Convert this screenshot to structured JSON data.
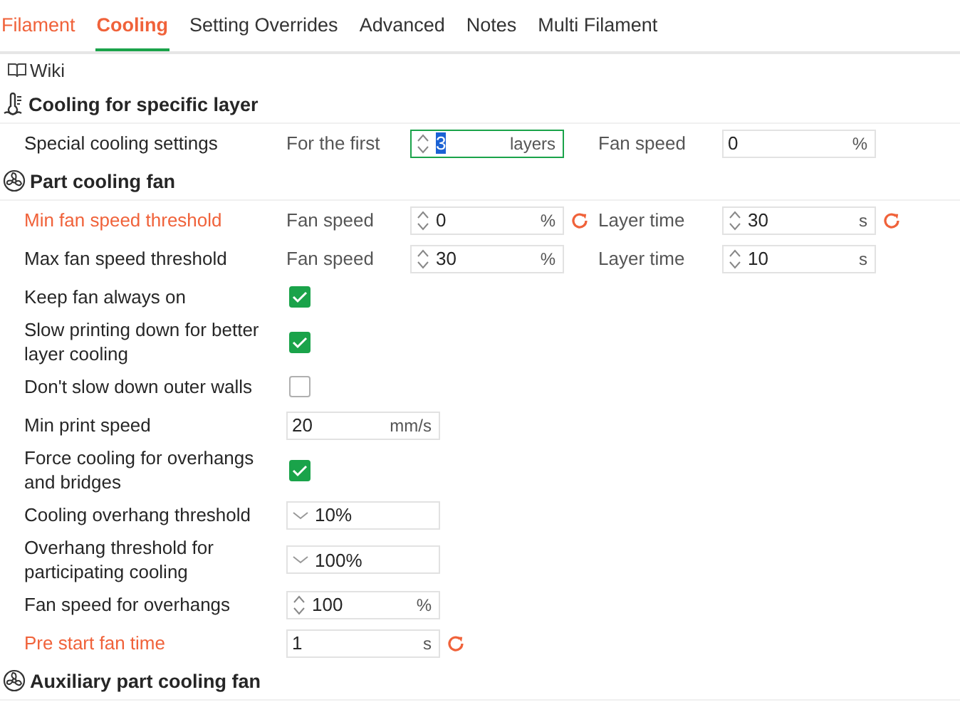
{
  "tabs": [
    {
      "label": "Filament",
      "selected": false,
      "modified": true
    },
    {
      "label": "Cooling",
      "selected": true,
      "modified": true
    },
    {
      "label": "Setting Overrides",
      "selected": false,
      "modified": false
    },
    {
      "label": "Advanced",
      "selected": false,
      "modified": false
    },
    {
      "label": "Notes",
      "selected": false,
      "modified": false
    },
    {
      "label": "Multi Filament",
      "selected": false,
      "modified": false
    }
  ],
  "wiki": {
    "label": "Wiki"
  },
  "sections": [
    {
      "title": "Cooling for specific layer",
      "kind": "thermometer",
      "rows": [
        {
          "kind": "pair",
          "label": "Special cooling settings",
          "modified": false,
          "fields": [
            {
              "caption": "For the first",
              "kind": "spin",
              "value": "3",
              "unit": "layers",
              "focused": true
            },
            {
              "caption": "Fan speed",
              "kind": "plain",
              "value": "0",
              "unit": "%",
              "focused": false
            }
          ]
        }
      ]
    },
    {
      "title": "Part cooling fan",
      "kind": "fan",
      "rows": [
        {
          "kind": "pair",
          "label": "Min fan speed threshold",
          "modified": true,
          "fields": [
            {
              "caption": "Fan speed",
              "kind": "spin",
              "value": "0",
              "unit": "%",
              "focused": false
            },
            {
              "caption": "Layer time",
              "kind": "spin",
              "value": "30",
              "unit": "s",
              "focused": false
            }
          ]
        },
        {
          "kind": "pair",
          "label": "Max fan speed threshold",
          "modified": false,
          "fields": [
            {
              "caption": "Fan speed",
              "kind": "spin",
              "value": "30",
              "unit": "%",
              "focused": false
            },
            {
              "caption": "Layer time",
              "kind": "spin",
              "value": "10",
              "unit": "s",
              "focused": false
            }
          ]
        },
        {
          "kind": "check",
          "label": "Keep fan always on",
          "modified": false,
          "checked": true
        },
        {
          "kind": "check",
          "label": "Slow printing down for better layer cooling",
          "modified": false,
          "checked": true
        },
        {
          "kind": "check",
          "label": "Don't slow down outer walls",
          "modified": false,
          "checked": false
        },
        {
          "kind": "field",
          "label": "Min print speed",
          "modified": false,
          "field": {
            "kind": "plain",
            "value": "20",
            "unit": "mm/s",
            "focused": false
          }
        },
        {
          "kind": "check",
          "label": "Force cooling for overhangs and bridges",
          "modified": false,
          "checked": true
        },
        {
          "kind": "field",
          "label": "Cooling overhang threshold",
          "modified": false,
          "field": {
            "kind": "dropdown",
            "value": "10%",
            "focused": false
          }
        },
        {
          "kind": "field",
          "label": "Overhang threshold for participating cooling",
          "modified": false,
          "field": {
            "kind": "dropdown",
            "value": "100%",
            "focused": false
          }
        },
        {
          "kind": "field",
          "label": "Fan speed for overhangs",
          "modified": false,
          "field": {
            "kind": "spin",
            "value": "100",
            "unit": "%",
            "focused": false
          }
        },
        {
          "kind": "field",
          "label": "Pre start fan time",
          "modified": true,
          "field": {
            "kind": "plain",
            "value": "1",
            "unit": "s",
            "focused": false
          }
        }
      ]
    },
    {
      "title": "Auxiliary part cooling fan",
      "kind": "fan"
    }
  ]
}
